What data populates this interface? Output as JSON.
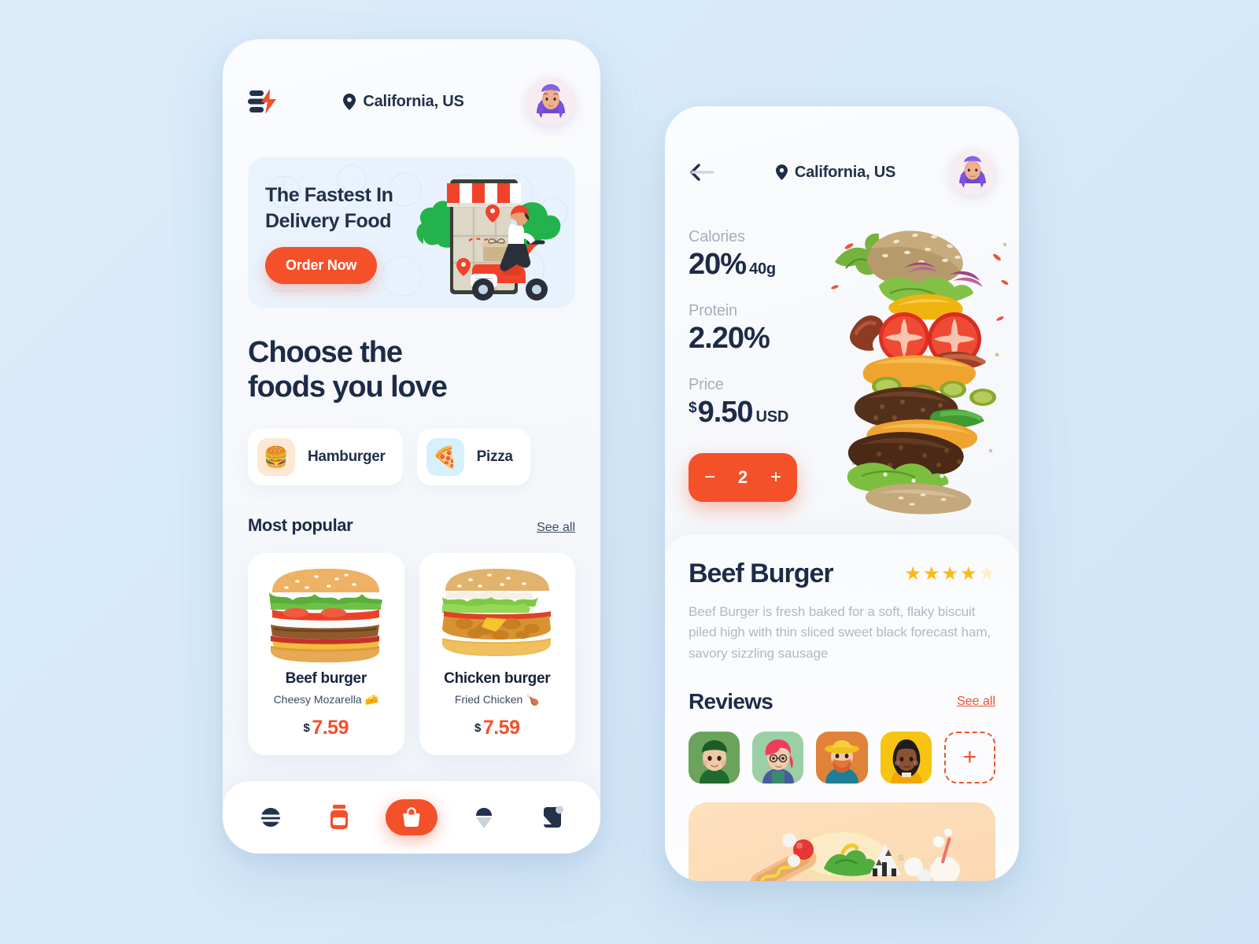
{
  "theme": {
    "background": "#d9ecfa",
    "accent": "#f4502a",
    "ink": "#1d2b47",
    "muted": "#a7afbc",
    "star": "#fdb813",
    "star_empty": "#fdeec4"
  },
  "home": {
    "logo_icon": "lightning-menu-logo",
    "location": "California, US",
    "location_icon": "map-pin-icon",
    "avatar_icon": "user-avatar",
    "banner": {
      "title": "The Fastest In\nDelivery Food",
      "cta": "Order Now",
      "illustration": "scooter-delivery-illustration"
    },
    "headline": "Choose the\nfoods you love",
    "categories": [
      {
        "label": "Hamburger",
        "emoji": "🍔",
        "icon_bg": "#fde8d4"
      },
      {
        "label": "Pizza",
        "emoji": "🍕",
        "icon_bg": "#d6f1fb"
      }
    ],
    "popular": {
      "title": "Most popular",
      "see_all": "See all",
      "items": [
        {
          "name": "Beef burger",
          "desc": "Cheesy Mozarella 🧀",
          "currency": "$",
          "price": "7.59",
          "image": "beef-burger-photo"
        },
        {
          "name": "Chicken burger",
          "desc": "Fried Chicken 🍗",
          "currency": "$",
          "price": "7.59",
          "image": "chicken-burger-photo"
        }
      ]
    },
    "tabs": [
      {
        "name": "menu",
        "icon": "burger-menu-icon",
        "active": false
      },
      {
        "name": "drinks",
        "icon": "drink-cup-icon",
        "active": false
      },
      {
        "name": "bag",
        "icon": "shopping-bag-icon",
        "active": true
      },
      {
        "name": "desserts",
        "icon": "ice-cream-icon",
        "active": false
      },
      {
        "name": "profile",
        "icon": "bookmark-badge-icon",
        "active": false
      }
    ]
  },
  "detail": {
    "back_icon": "back-arrow-icon",
    "location": "California, US",
    "location_icon": "map-pin-icon",
    "avatar_icon": "user-avatar",
    "nutrition": [
      {
        "label": "Calories",
        "value": "20%",
        "sub": "40g",
        "pre": ""
      },
      {
        "label": "Protein",
        "value": "2.20%",
        "sub": "",
        "pre": ""
      },
      {
        "label": "Price",
        "value": "9.50",
        "sub": "USD",
        "pre": "$"
      }
    ],
    "quantity": {
      "decrement": "−",
      "value": "2",
      "increment": "+"
    },
    "hero_image": "stacked-beef-burger-photo",
    "product_title": "Beef Burger",
    "rating": {
      "filled": 4,
      "total": 5
    },
    "description": "Beef Burger is fresh baked for a soft, flaky biscuit piled high with thin sliced sweet black forecast ham, savory sizzling sausage",
    "reviews": {
      "title": "Reviews",
      "see_all": "See all",
      "avatars": [
        {
          "name": "reviewer-1",
          "bg": "#6aa35c"
        },
        {
          "name": "reviewer-2",
          "bg": "#9bcfa6"
        },
        {
          "name": "reviewer-3",
          "bg": "#e0823a"
        },
        {
          "name": "reviewer-4",
          "bg": "#f7c411"
        }
      ],
      "add_label": "+"
    },
    "promo": {
      "name": "food-promo-banner"
    }
  }
}
